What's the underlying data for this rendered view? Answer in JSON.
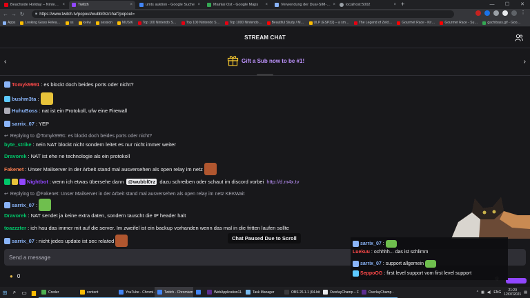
{
  "browser": {
    "tabs": [
      {
        "label": "Beachside Holiday – Ninten…",
        "color": "#e60012"
      },
      {
        "label": "Twitch",
        "color": "#9147ff",
        "active": true
      },
      {
        "label": "umts auktion - Google Suche",
        "color": "#4285f4"
      },
      {
        "label": "Mainlai Ost - Google Maps",
        "color": "#34a853"
      },
      {
        "label": "Verwendung der Dual-SIM-Funk…",
        "color": "#8ab4f8"
      },
      {
        "label": "localhost:5002",
        "color": "#9aa0a6"
      }
    ],
    "url": "https://www.twitch.tv/popout/wubbl0rz/chat?popout=",
    "bookmarks": [
      {
        "label": "Apps",
        "color": "#8ab4f8"
      },
      {
        "label": "Looking Glass Relea…",
        "color": "#fbbc04"
      },
      {
        "label": "ss",
        "color": "#fbbc04"
      },
      {
        "label": "kekw",
        "color": "#fbbc04"
      },
      {
        "label": "session",
        "color": "#fbbc04"
      },
      {
        "label": "MUSIK",
        "color": "#fbbc04"
      },
      {
        "label": "Top 100 Nintendo S…",
        "color": "#e60012"
      },
      {
        "label": "Top 100 Nintendo S…",
        "color": "#e60012"
      },
      {
        "label": "Top 1000 Nintendo…",
        "color": "#e60012"
      },
      {
        "label": "Beautiful Study / M…",
        "color": "#ff0000"
      },
      {
        "label": "ULP (ESP32) – a sm…",
        "color": "#fbbc04"
      },
      {
        "label": "The Legend of Zeld…",
        "color": "#e60012"
      },
      {
        "label": "Gourmet Race - Kir…",
        "color": "#ff0000"
      },
      {
        "label": "Gourmet Race - Su…",
        "color": "#ff0000"
      },
      {
        "label": "gachibass.gif - Goo…",
        "color": "#34a853"
      }
    ]
  },
  "chat": {
    "title": "STREAM CHAT",
    "sub_banner": "Gift a Sub now to be #1!",
    "paused": "Chat Paused Due to Scroll",
    "input_placeholder": "Send a message",
    "points": "0",
    "messages": [
      {
        "user": "Tomyk9991",
        "color": "#ff4a4a",
        "text": "es blockt doch beides ports oder nicht?",
        "badge": "#8ab4f8"
      },
      {
        "user": "bushm3ta",
        "color": "#8ab4f8",
        "text": "",
        "badge": "#5cc8ff",
        "emote": "#e8c33a"
      },
      {
        "user": "HuhuBoss",
        "color": "#8ab4f8",
        "text": "nat ist ein Protokoll, ufw eine Firewall",
        "badge": "#adadb8"
      },
      {
        "user": "sarrix_07",
        "color": "#8ab4f8",
        "text": "YEP",
        "badge": "#8ab4f8"
      },
      {
        "reply": "Replying to @Tomyk9991: es blockt doch beides ports oder nicht?",
        "user": "byte_strike",
        "color": "#00c76a",
        "text": "nein NAT blockt nicht sondern leitet es nur nicht immer weiter"
      },
      {
        "user": "Dravorek",
        "color": "#00c76a",
        "text": "NAT ist ehe ne technologie als ein protokoll"
      },
      {
        "user": "Fakenet",
        "color": "#ff7f50",
        "text": "Unser Mailserver in der Arbeit stand mal ausversehen als open relay im netz",
        "emote": "#b0562f"
      },
      {
        "user": "Nightbot",
        "color": "#9147ff",
        "text_before": "wenn ich etwas übersehe dann ",
        "mention": "@wubbl0rz",
        "text_after": " dazu schreiben oder schaut im discord vorbei ",
        "link": "http://d.m4x.tv"
      },
      {
        "reply": "Replying to @Fakenet: Unser Mailserver in der Arbeit stand mal ausversehen als open relay im netz KEKWait",
        "user": "sarrix_07",
        "color": "#8ab4f8",
        "text": "",
        "badge": "#8ab4f8",
        "emote": "#6fbf4e"
      },
      {
        "user": "Dravorek",
        "color": "#00c76a",
        "text": "NAT sendet ja keine extra daten, sondern tauscht die IP header halt"
      },
      {
        "user": "toazzzter",
        "color": "#00c76a",
        "text": "ich hau das immer mit auf die server. Im zweifel ist ein backup vorhanden wenn das mal in die fritten laufen sollte"
      },
      {
        "user": "sarrix_07",
        "color": "#8ab4f8",
        "text": "nicht jedes update ist sec related",
        "badge": "#8ab4f8",
        "emote": "#b0562f"
      }
    ]
  },
  "overlay": {
    "messages": [
      {
        "user": "sarrix_07",
        "color": "#8ab4f8",
        "text": "",
        "emote": "#6fbf4e"
      },
      {
        "user": "Luekuu",
        "color": "#ff4a4a",
        "text": "ochhhh... das ist schlimm"
      },
      {
        "user": "sarrix_07",
        "color": "#8ab4f8",
        "text": "support allgemein",
        "emote": "#6fbf4e"
      },
      {
        "user": "SeppoOG",
        "color": "#ff4a4a",
        "text": "first level support vom first level support"
      }
    ]
  },
  "taskbar": {
    "apps": [
      {
        "label": "Creder",
        "color": "#4caf50"
      },
      {
        "label": "content",
        "color": "#fbbc04"
      },
      {
        "label": "YouTube - Chromi…",
        "color": "#4285f4"
      },
      {
        "label": "Twitch - Chromium",
        "color": "#4285f4",
        "active": true
      },
      {
        "label": "",
        "color": "#4285f4"
      },
      {
        "label": "WebApplication11…",
        "color": "#5c2d91"
      },
      {
        "label": "Task Manager",
        "color": "#76b9ed"
      },
      {
        "label": "OBS 26.1.1 (64-bit,…",
        "color": "#3a3a3d"
      },
      {
        "label": "OverlayChamp – F…",
        "color": "#e8eaed"
      },
      {
        "label": "OverlayChamp -",
        "color": "#5c2d91"
      }
    ],
    "language": "ENG",
    "time": "21:20",
    "date": "12/07/2021"
  }
}
